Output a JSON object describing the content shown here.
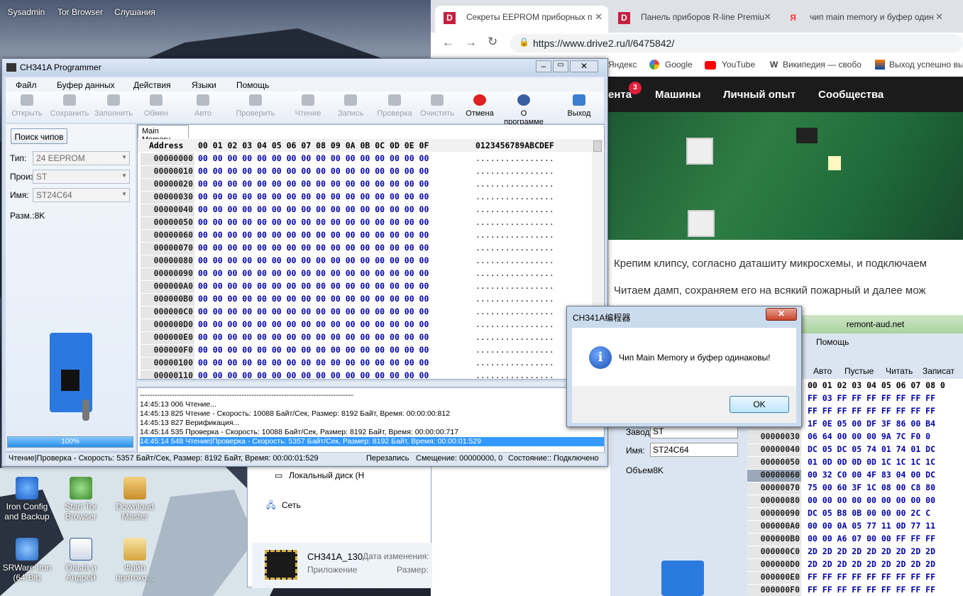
{
  "desktop": {
    "top_icons": [
      "Sysadmin",
      "Tor Browser",
      "Слушания"
    ],
    "icons": [
      {
        "label1": "Iron Config",
        "label2": "and Backup"
      },
      {
        "label1": "Start Tor",
        "label2": "Browser"
      },
      {
        "label1": "Download",
        "label2": "Master"
      },
      {
        "label1": "SRWare Iron",
        "label2": "(64-Bit)"
      },
      {
        "label1": "Ольга и",
        "label2": "Андрей"
      },
      {
        "label1": "Файл",
        "label2": "протоко..."
      }
    ]
  },
  "browser": {
    "tabs": [
      "Секреты EEPROM приборных п",
      "Панель приборов R-line Premiu",
      "чип main memory и буфер один"
    ],
    "url": "https://www.drive2.ru/l/6475842/",
    "bookmarks": [
      "Яндекс",
      "Google",
      "YouTube",
      "Википедия — свобо",
      "Выход успешно вы"
    ],
    "nav": [
      "ента",
      "Машины",
      "Личный опыт",
      "Сообщества"
    ],
    "nav_badge": "3",
    "paragraph1": "Крепим клипсу, согласно даташиту микросхемы, и подключаем",
    "paragraph2": "Читаем дамп, сохраняем его на всякий пожарный и далее мож"
  },
  "explorer": {
    "items": [
      "Локальный диск (H",
      "Сеть"
    ],
    "file_name": "CH341A_130",
    "file_type": "Приложение",
    "col_date": "Дата изменения:",
    "col_size": "Размер:"
  },
  "programmer": {
    "title": "CH341A Programmer",
    "menu": [
      "Файл",
      "Буфер данных",
      "Действия",
      "Языки",
      "Помощь"
    ],
    "toolbar": [
      "Открыть",
      "Сохранить",
      "Заполнить",
      "Обмен",
      "Авто",
      "Проверить",
      "Чтение",
      "Запись",
      "Проверка",
      "Очистить",
      "Отмена",
      "О программе",
      "Выход"
    ],
    "search_btn": "Поиск чипов",
    "type_label": "Тип:",
    "type_value": "24 EEPROM",
    "mfr_label": "Произ:",
    "mfr_value": "ST",
    "name_label": "Имя:",
    "name_value": "ST24C64",
    "size_label": "Разм.:8K",
    "progress": "100%",
    "progress_value": 1.0,
    "tab": "Main Memory",
    "address_header": "Address",
    "hex_header": "00 01 02 03 04 05 06 07 08 09 0A 0B 0C 0D 0E 0F",
    "ascii_header": "0123456789ABCDEF",
    "addresses": [
      "00000000",
      "00000010",
      "00000020",
      "00000030",
      "00000040",
      "00000050",
      "00000060",
      "00000070",
      "00000080",
      "00000090",
      "000000A0",
      "000000B0",
      "000000C0",
      "000000D0",
      "000000E0",
      "000000F0",
      "00000100",
      "00000110"
    ],
    "hex_row": "00 00 00 00 00 00 00 00 00 00 00 00 00 00 00 00",
    "ascii_row": "................",
    "log": [
      "--------------------------------------------------------------------------------------",
      "14:45:13 006 Чтение...",
      "14:45:13 825 Чтение - Скорость: 10088 Байт/Сек, Размер: 8192 Байт, Время: 00:00:00:812",
      "14:45:13 827 Верификация...",
      "14:45:14 535 Проверка - Скорость: 10088 Байт/Сек, Размер: 8192 Байт, Время: 00:00:00:717",
      "14:45:14 548 Чтение|Проверка - Скорость: 5357 Байт/Сек, Размер: 8192 Байт, Время: 00:00:01:529"
    ],
    "status": [
      "Чтение|Проверка - Скорость: 5357 Байт/Сек, Размер: 8192 Байт, Время: 00:00:01:529",
      "Перезапись",
      "Смещение: 00000000, 0",
      "Состояние:: Подключено"
    ]
  },
  "programmer2": {
    "title": "remont-aud.net",
    "menu": "Помощь",
    "toolbar": [
      "Авто",
      "Пустые",
      "Читать",
      "Записат"
    ],
    "mfr_label": "Завод:",
    "mfr_value": "ST",
    "name_label": "Имя:",
    "name_value": "ST24C64",
    "size_label": "Объем8K",
    "hex_header": "00 01 02 03 04 05 06 07 08 0",
    "rows": [
      {
        "addr": "",
        "hex": "FF 03 FF FF FF FF FF FF FF"
      },
      {
        "addr": "",
        "hex": "FF FF FF FF FF FF FF FF FF"
      },
      {
        "addr": "",
        "hex": "1F 0E 05 00 DF 3F 86 00 B4"
      },
      {
        "addr": "00000030",
        "hex": "06 64 00 00 00 9A 7C F0 0"
      },
      {
        "addr": "00000040",
        "hex": "DC 05 DC 05 74 01 74 01 DC"
      },
      {
        "addr": "00000050",
        "hex": "01 0D 0D 0D 0D 1C 1C 1C 1C"
      },
      {
        "addr": "00000060",
        "hex": "00 32 C0 00 4F 83 04 00 DC"
      },
      {
        "addr": "00000070",
        "hex": "75 00 60 3F 1C 08 00 C8 80"
      },
      {
        "addr": "00000080",
        "hex": "00 00 00 00 00 00 00 00 00"
      },
      {
        "addr": "00000090",
        "hex": "DC 05 B8 0B 00 00 00 2C C"
      },
      {
        "addr": "000000A0",
        "hex": "00 00 0A 05 77 11 0D 77 11"
      },
      {
        "addr": "000000B0",
        "hex": "00 00 A6 07 00 00 FF FF FF"
      },
      {
        "addr": "000000C0",
        "hex": "2D 2D 2D 2D 2D 2D 2D 2D 2D"
      },
      {
        "addr": "000000D0",
        "hex": "2D 2D 2D 2D 2D 2D 2D 2D 2D"
      },
      {
        "addr": "000000E0",
        "hex": "FF FF FF FF FF FF FF FF FF"
      },
      {
        "addr": "000000F0",
        "hex": "FF FF FF FF FF FF FF FF FF"
      }
    ]
  },
  "dialog": {
    "title": "CH341A编程器",
    "message": "Чип Main Memory и буфер одинаковы!",
    "ok": "OK"
  },
  "colors": {
    "accent": "#3399ff",
    "hex_blue": "#0000aa",
    "cancel_red": "#e02020"
  }
}
